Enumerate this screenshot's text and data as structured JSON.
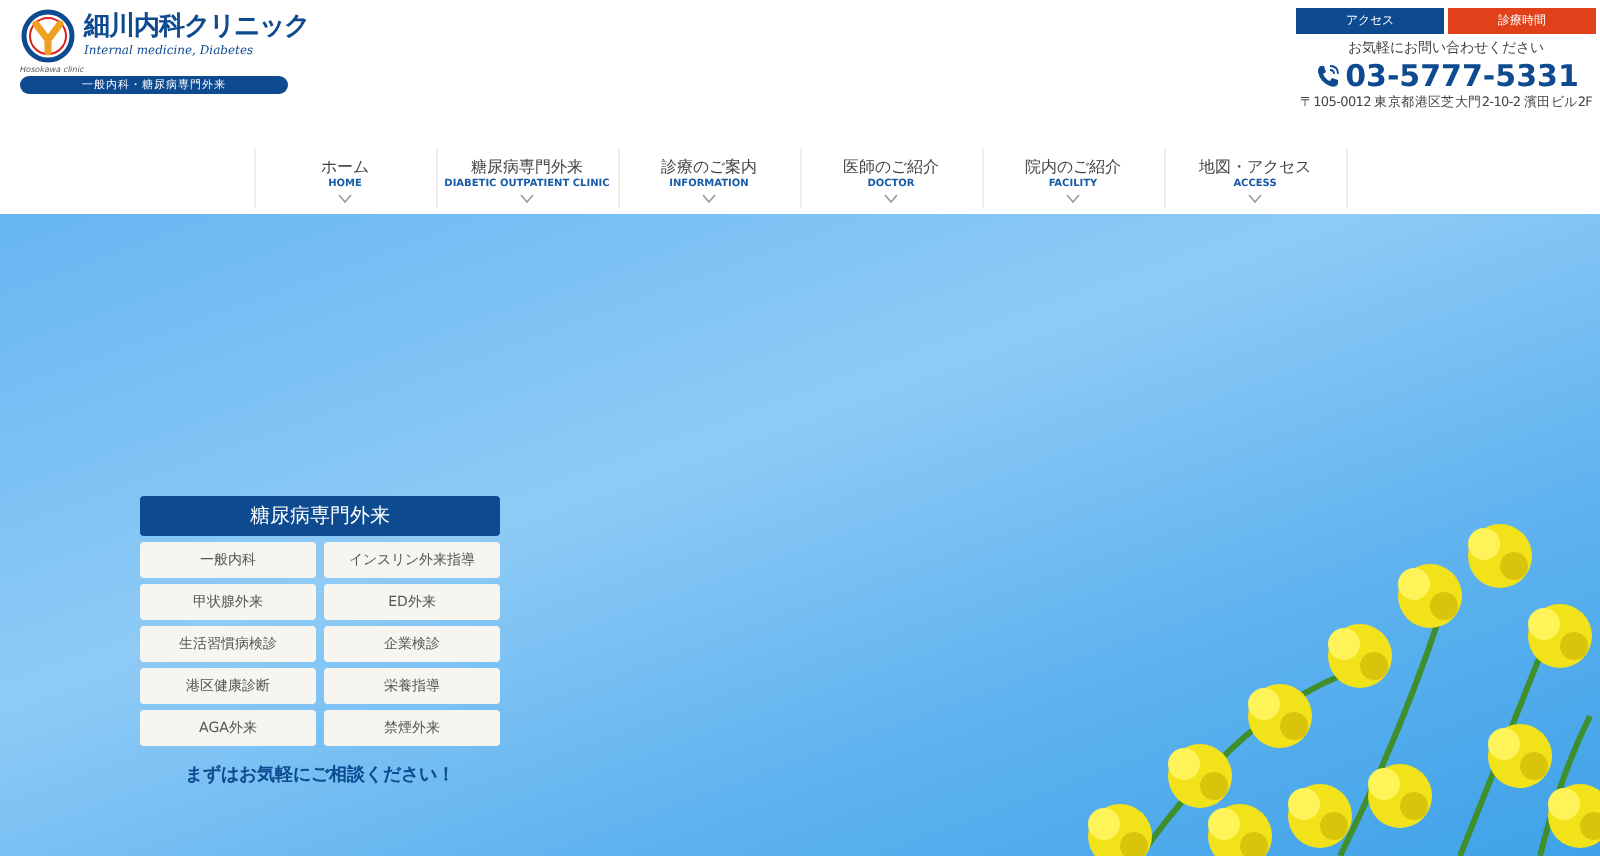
{
  "logo": {
    "name": "細川内科クリニック",
    "subtitle": "Internal medicine, Diabetes",
    "clinic_tag": "Hosokawa clinic",
    "tagline": "一般内科・糖尿病専門外来"
  },
  "header_buttons": [
    {
      "label": "アクセス",
      "kind": "access"
    },
    {
      "label": "診療時間",
      "kind": "hours"
    }
  ],
  "contact": {
    "note": "お気軽にお問い合わせください",
    "phone": "03-5777-5331",
    "address": "〒105-0012 東京都港区芝大門2-10-2 濱田ビル2F"
  },
  "nav": [
    {
      "label": "ホーム",
      "sub": "HOME"
    },
    {
      "label": "糖尿病専門外来",
      "sub": "DIABETIC OUTPATIENT CLINIC"
    },
    {
      "label": "診療のご案内",
      "sub": "INFORMATION"
    },
    {
      "label": "医師のご紹介",
      "sub": "DOCTOR"
    },
    {
      "label": "院内のご紹介",
      "sub": "FACILITY"
    },
    {
      "label": "地図・アクセス",
      "sub": "ACCESS"
    }
  ],
  "services": {
    "title": "糖尿病専門外来",
    "items": [
      "一般内科",
      "インスリン外来指導",
      "甲状腺外来",
      "ED外来",
      "生活習慣病検診",
      "企業検診",
      "港区健康診断",
      "栄養指導",
      "AGA外来",
      "禁煙外来"
    ],
    "cta": "まずはお気軽にご相談ください！"
  }
}
